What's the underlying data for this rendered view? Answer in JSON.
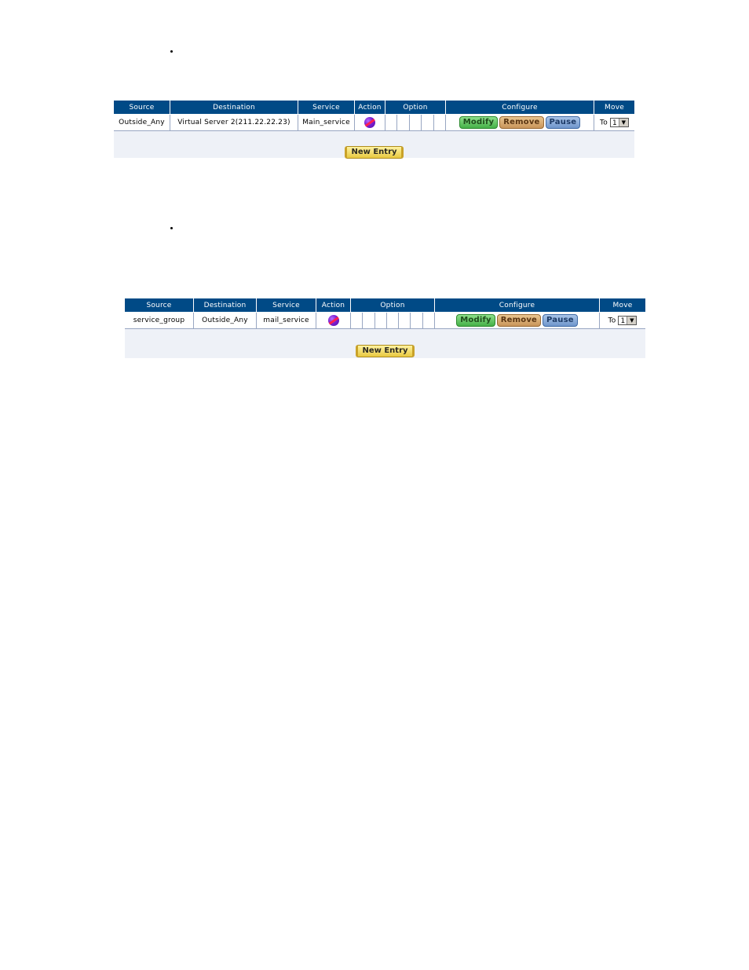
{
  "tables": [
    {
      "headers": [
        "Source",
        "Destination",
        "Service",
        "Action",
        "Option",
        "Configure",
        "Move"
      ],
      "row": {
        "source": "Outside_Any",
        "destination": "Virtual Server 2(211.22.22.23)",
        "service": "Main_service",
        "action_icon": "permit-icon",
        "move_prefix": "To",
        "move_value": "1"
      },
      "buttons": {
        "modify": "Modify",
        "remove": "Remove",
        "pause": "Pause",
        "new_entry": "New Entry"
      }
    },
    {
      "headers": [
        "Source",
        "Destination",
        "Service",
        "Action",
        "Option",
        "Configure",
        "Move"
      ],
      "row": {
        "source": "service_group",
        "destination": "Outside_Any",
        "service": "mail_service",
        "action_icon": "permit-icon",
        "move_prefix": "To",
        "move_value": "1"
      },
      "buttons": {
        "modify": "Modify",
        "remove": "Remove",
        "pause": "Pause",
        "new_entry": "New Entry"
      }
    }
  ],
  "colors": {
    "header_bg": "#004a86",
    "panel_bg": "#eef1f7"
  }
}
